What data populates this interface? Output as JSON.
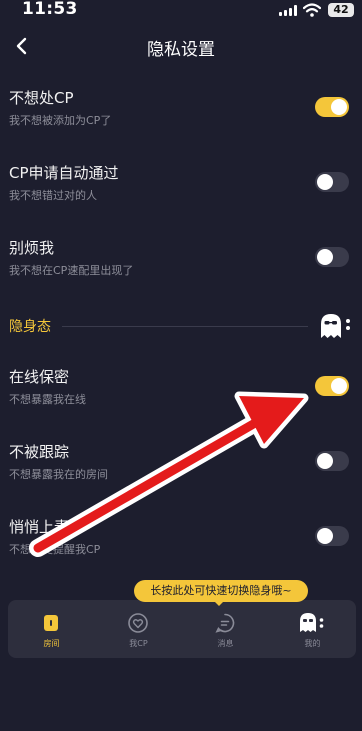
{
  "status_bar": {
    "time": "11:53",
    "battery": "42"
  },
  "header": {
    "title": "隐私设置",
    "back_icon": "chevron-left-icon"
  },
  "settings": [
    {
      "title": "不想处CP",
      "subtitle": "我不想被添加为CP了",
      "enabled": true
    },
    {
      "title": "CP申请自动通过",
      "subtitle": "我不想错过对的人",
      "enabled": false
    },
    {
      "title": "别烦我",
      "subtitle": "我不想在CP速配里出现了",
      "enabled": false
    }
  ],
  "invisible_section": {
    "label": "隐身态",
    "icon": "ghost-icon",
    "settings": [
      {
        "title": "在线保密",
        "subtitle": "不想暴露我在线",
        "enabled": true
      },
      {
        "title": "不被跟踪",
        "subtitle": "不想暴露我在的房间",
        "enabled": false
      },
      {
        "title": "悄悄上麦",
        "subtitle": "不想上麦提醒我CP",
        "enabled": false
      }
    ]
  },
  "tooltip": {
    "text": "长按此处可快速切换隐身哦~"
  },
  "tabs": [
    {
      "label": "房间",
      "icon": "room-icon",
      "active": true
    },
    {
      "label": "我CP",
      "icon": "heart-icon",
      "active": false
    },
    {
      "label": "消息",
      "icon": "message-icon",
      "active": false
    },
    {
      "label": "我的",
      "icon": "ghost-icon",
      "active": false
    }
  ],
  "colors": {
    "accent": "#f4c63a",
    "background": "#1d1e2e",
    "annotation_arrow": "#e41b1b"
  }
}
